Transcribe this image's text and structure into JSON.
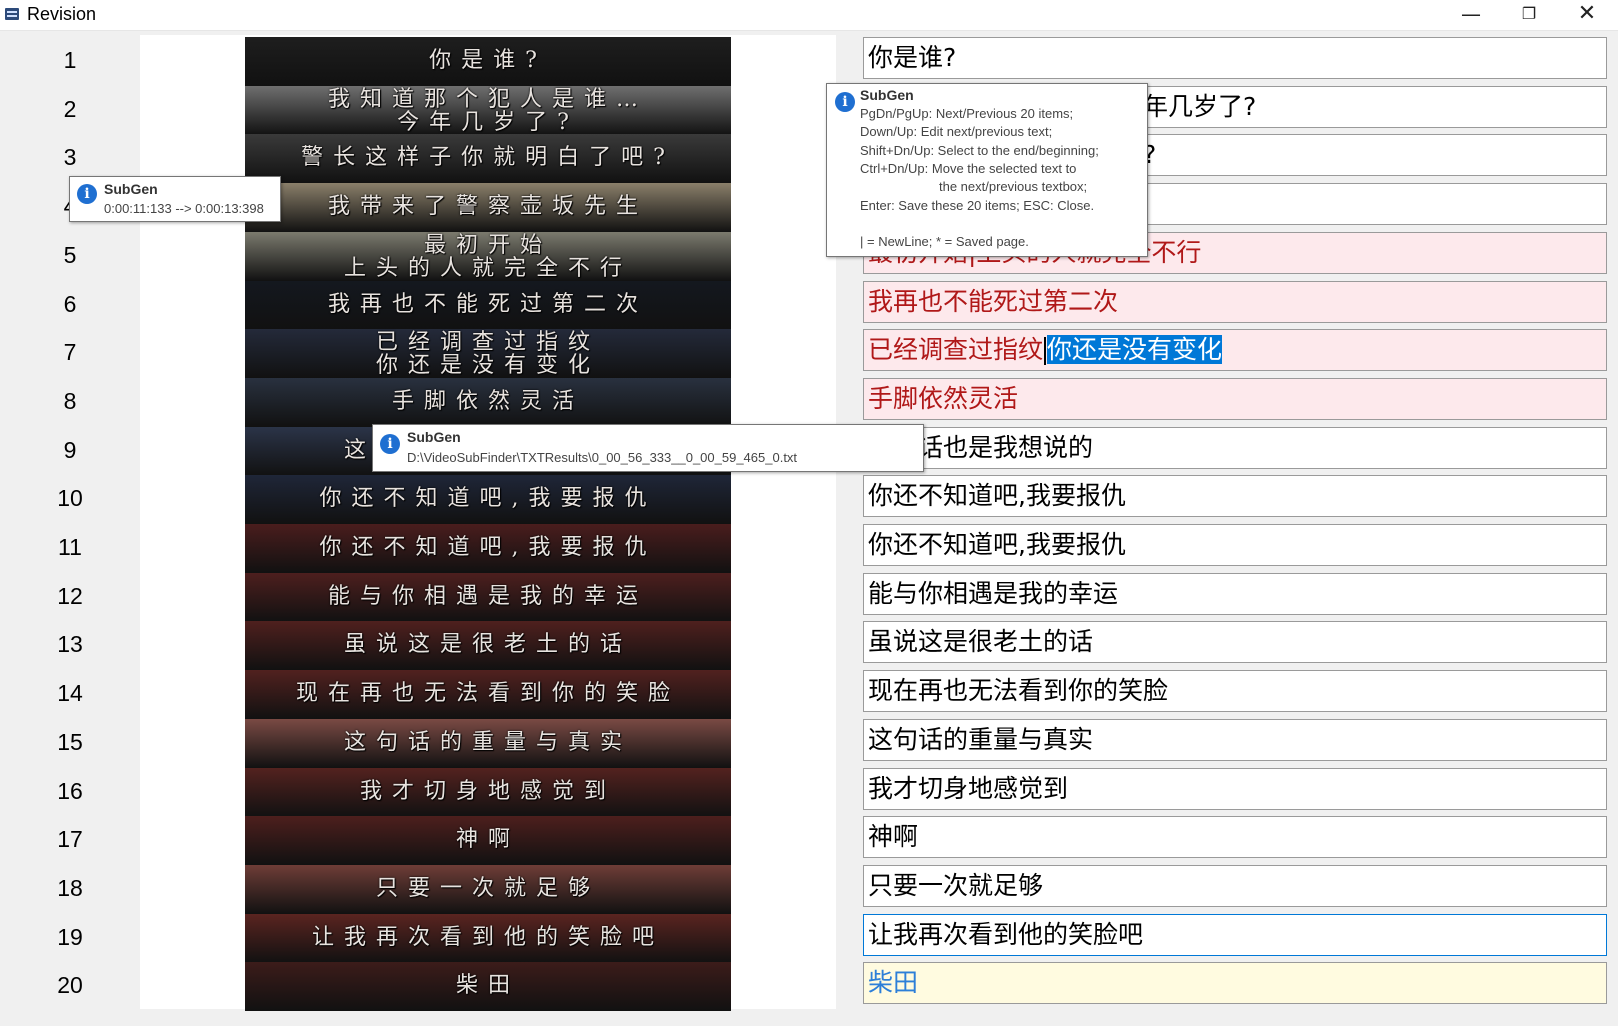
{
  "window": {
    "title": "Revision",
    "minimize_glyph": "—",
    "restore_glyph": "❐",
    "close_glyph": "✕"
  },
  "rows": [
    {
      "num": "1",
      "text": "你是谁?",
      "state": "normal"
    },
    {
      "num": "2",
      "text": "我知道那个犯人是谁…今年几岁了?",
      "state": "normal"
    },
    {
      "num": "3",
      "text": "警长这样子你就明白了吧?",
      "state": "normal"
    },
    {
      "num": "4",
      "text": "我带来了警察壶坂先生",
      "state": "normal"
    },
    {
      "num": "5",
      "text": "最初开始|上头的人就完全不行",
      "state": "pink"
    },
    {
      "num": "6",
      "text": "我再也不能死过第二次",
      "state": "pink"
    },
    {
      "num": "7",
      "text_before": "已经调查过指纹",
      "text_selected": "你还是没有变化",
      "state": "pink"
    },
    {
      "num": "8",
      "text": "手脚依然灵活",
      "state": "pink"
    },
    {
      "num": "9",
      "text": "这句话也是我想说的",
      "state": "normal"
    },
    {
      "num": "10",
      "text": "你还不知道吧,我要报仇",
      "state": "normal"
    },
    {
      "num": "11",
      "text": "你还不知道吧,我要报仇",
      "state": "normal"
    },
    {
      "num": "12",
      "text": "能与你相遇是我的幸运",
      "state": "normal"
    },
    {
      "num": "13",
      "text": "虽说这是很老土的话",
      "state": "normal"
    },
    {
      "num": "14",
      "text": "现在再也无法看到你的笑脸",
      "state": "normal"
    },
    {
      "num": "15",
      "text": "这句话的重量与真实",
      "state": "normal"
    },
    {
      "num": "16",
      "text": "我才切身地感觉到",
      "state": "normal"
    },
    {
      "num": "17",
      "text": "神啊",
      "state": "normal"
    },
    {
      "num": "18",
      "text": "只要一次就足够",
      "state": "normal"
    },
    {
      "num": "19",
      "text": "让我再次看到他的笑脸吧",
      "state": "focused"
    },
    {
      "num": "20",
      "text": "柴田",
      "state": "yellow"
    }
  ],
  "frames": [
    {
      "lines": [
        "你是谁?"
      ],
      "bg": "#1e1e1e"
    },
    {
      "lines": [
        "我知道那个犯人是谁…",
        "今年几岁了?"
      ],
      "bg": "#6f6f6f"
    },
    {
      "lines": [
        "警长这样子你就明白了吧?"
      ],
      "bg": "#3a3a3a"
    },
    {
      "lines": [
        "我带来了警察壶坂先生"
      ],
      "bg": "#8a7f6a"
    },
    {
      "lines": [
        "最初开始",
        "上头的人就完全不行"
      ],
      "bg": "#7b7a6e"
    },
    {
      "lines": [
        "我再也不能死过第二次"
      ],
      "bg": "#14181f"
    },
    {
      "lines": [
        "已经调查过指纹",
        "你还是没有变化"
      ],
      "bg": "#242a3a"
    },
    {
      "lines": [
        "手脚依然灵活"
      ],
      "bg": "#29313f"
    },
    {
      "lines": [
        "这句话也是我想说的"
      ],
      "bg": "#2b3448"
    },
    {
      "lines": [
        "你还不知道吧,我要报仇"
      ],
      "bg": "#1f2638"
    },
    {
      "lines": [
        "你还不知道吧,我要报仇"
      ],
      "bg": "#4a1d1d"
    },
    {
      "lines": [
        "能与你相遇是我的幸运"
      ],
      "bg": "#4d1f1e"
    },
    {
      "lines": [
        "虽说这是很老土的话"
      ],
      "bg": "#4f201e"
    },
    {
      "lines": [
        "现在再也无法看到你的笑脸"
      ],
      "bg": "#51211f"
    },
    {
      "lines": [
        "这句话的重量与真实"
      ],
      "bg": "#7a4a44"
    },
    {
      "lines": [
        "我才切身地感觉到"
      ],
      "bg": "#53221f"
    },
    {
      "lines": [
        "神啊"
      ],
      "bg": "#4d1f1d"
    },
    {
      "lines": [
        "只要一次就足够"
      ],
      "bg": "#6e3d37"
    },
    {
      "lines": [
        "让我再次看到他的笑脸吧"
      ],
      "bg": "#5a2420"
    },
    {
      "lines": [
        "柴田"
      ],
      "bg": "#3c1c1a"
    }
  ],
  "tooltip_help": {
    "title": "SubGen",
    "lines": [
      "PgDn/PgUp: Next/Previous 20 items;",
      "Down/Up: Edit next/previous text;",
      "Shift+Dn/Up: Select to the end/beginning;",
      "Ctrl+Dn/Up: Move the selected text to",
      "the next/previous textbox;",
      "Enter: Save these 20 items; ESC: Close.",
      "",
      "| = NewLine; * = Saved page."
    ]
  },
  "tooltip_time": {
    "title": "SubGen",
    "text": "0:00:11:133 --> 0:00:13:398"
  },
  "tooltip_path": {
    "title": "SubGen",
    "text": "D:\\VideoSubFinder\\TXTResults\\0_00_56_333__0_00_59_465_0.txt"
  },
  "icons": {
    "info": "i"
  }
}
